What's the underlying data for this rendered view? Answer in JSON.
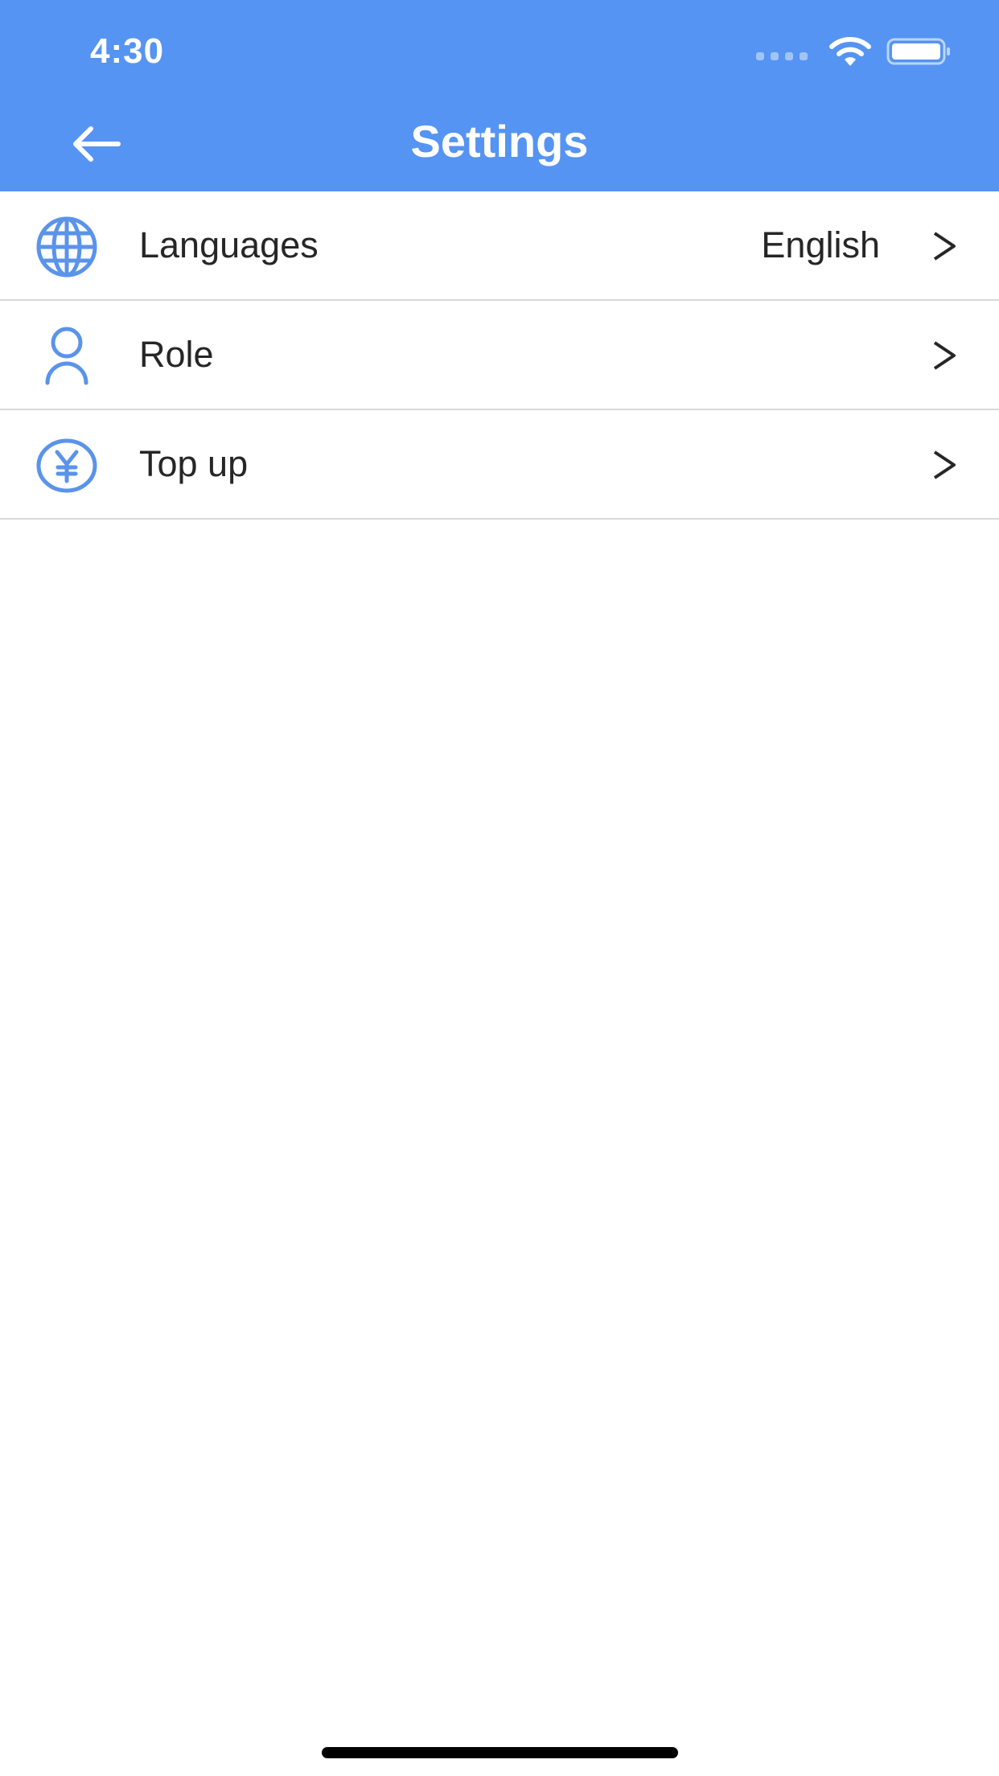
{
  "status_bar": {
    "time": "4:30"
  },
  "nav": {
    "title": "Settings"
  },
  "settings": {
    "items": [
      {
        "label": "Languages",
        "value": "English",
        "icon": "globe-icon"
      },
      {
        "label": "Role",
        "value": "",
        "icon": "user-icon"
      },
      {
        "label": "Top up",
        "value": "",
        "icon": "yen-coin-icon"
      }
    ]
  },
  "colors": {
    "header": "#5594f2",
    "icon": "#5a93ea",
    "text": "#262626",
    "divider": "#d9d9d9"
  }
}
